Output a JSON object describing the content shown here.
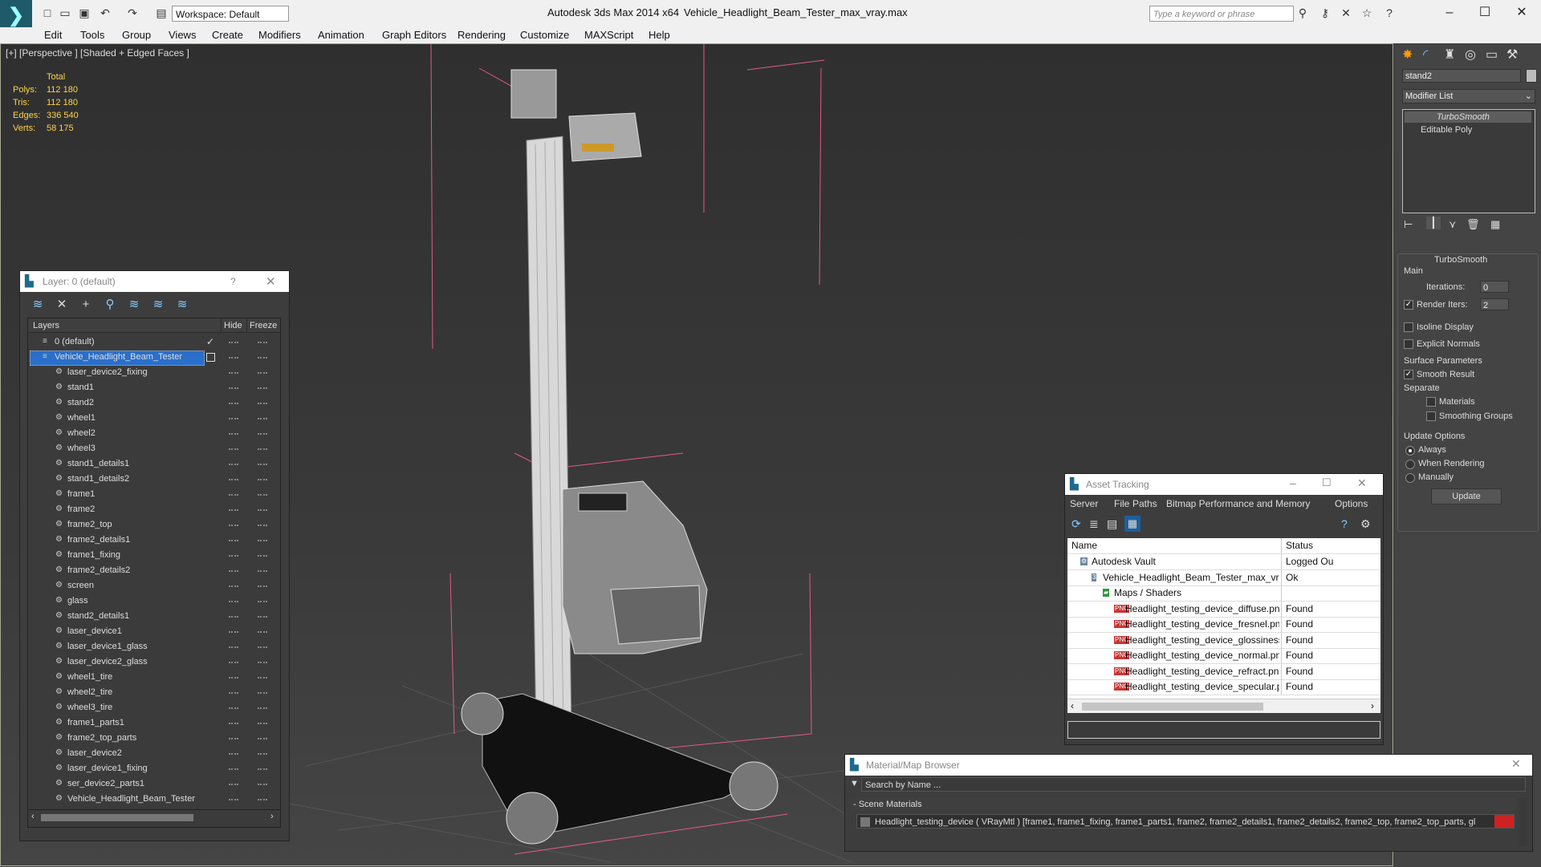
{
  "titlebar": {
    "app": "Autodesk 3ds Max  2014 x64",
    "file": "Vehicle_Headlight_Beam_Tester_max_vray.max",
    "workspace": "Workspace: Default",
    "search_placeholder": "Type a keyword or phrase"
  },
  "menu": [
    "Edit",
    "Tools",
    "Group",
    "Views",
    "Create",
    "Modifiers",
    "Animation",
    "Graph Editors",
    "Rendering",
    "Customize",
    "MAXScript",
    "Help"
  ],
  "viewport": {
    "label": "[+] [Perspective ] [Shaded + Edged Faces ]",
    "stats": {
      "header": "Total",
      "polys_label": "Polys:",
      "polys": "112 180",
      "tris_label": "Tris:",
      "tris": "112 180",
      "edges_label": "Edges:",
      "edges": "336 540",
      "verts_label": "Verts:",
      "verts": "58 175"
    }
  },
  "layer_window": {
    "title": "Layer: 0 (default)",
    "help": "?",
    "columns": {
      "layers": "Layers",
      "hide": "Hide",
      "freeze": "Freeze"
    },
    "rows": [
      "0 (default)",
      "Vehicle_Headlight_Beam_Tester",
      "laser_device2_fixing",
      "stand1",
      "stand2",
      "wheel1",
      "wheel2",
      "wheel3",
      "stand1_details1",
      "stand1_details2",
      "frame1",
      "frame2",
      "frame2_top",
      "frame2_details1",
      "frame1_fixing",
      "frame2_details2",
      "screen",
      "glass",
      "stand2_details1",
      "laser_device1",
      "laser_device1_glass",
      "laser_device2_glass",
      "wheel1_tire",
      "wheel2_tire",
      "wheel3_tire",
      "frame1_parts1",
      "frame2_top_parts",
      "laser_device2",
      "laser_device1_fixing",
      "ser_device2_parts1",
      "Vehicle_Headlight_Beam_Tester"
    ]
  },
  "command_panel": {
    "object_name": "stand2",
    "modifier_list": "Modifier List",
    "stack": [
      "TurboSmooth",
      "Editable Poly"
    ],
    "rollout_title": "TurboSmooth",
    "main_label": "Main",
    "iterations_label": "Iterations:",
    "iterations": "0",
    "render_iters_label": "Render Iters:",
    "render_iters": "2",
    "isoline": "Isoline Display",
    "explicit_normals": "Explicit Normals",
    "surface_params": "Surface Parameters",
    "smooth_result": "Smooth Result",
    "separate": "Separate",
    "materials": "Materials",
    "smoothing_groups": "Smoothing Groups",
    "update_options": "Update Options",
    "always": "Always",
    "when_rendering": "When Rendering",
    "manually": "Manually",
    "update_btn": "Update"
  },
  "asset_tracking": {
    "title": "Asset Tracking",
    "menu": [
      "Server",
      "File",
      "Paths",
      "Bitmap Performance and Memory",
      "Options"
    ],
    "col_name": "Name",
    "col_status": "Status",
    "rows": [
      {
        "name": "Autodesk Vault",
        "status": "Logged Ou"
      },
      {
        "name": "Vehicle_Headlight_Beam_Tester_max_vray.max",
        "status": "Ok"
      },
      {
        "name": "Maps / Shaders",
        "status": ""
      },
      {
        "name": "Headlight_testing_device_diffuse.png",
        "status": "Found"
      },
      {
        "name": "Headlight_testing_device_fresnel.png",
        "status": "Found"
      },
      {
        "name": "Headlight_testing_device_glossiness.png",
        "status": "Found"
      },
      {
        "name": "Headlight_testing_device_normal.png",
        "status": "Found"
      },
      {
        "name": "Headlight_testing_device_refract.png",
        "status": "Found"
      },
      {
        "name": "Headlight_testing_device_specular.png",
        "status": "Found"
      }
    ]
  },
  "material_browser": {
    "title": "Material/Map Browser",
    "search_placeholder": "Search by Name ...",
    "section": "- Scene Materials",
    "entry": "Headlight_testing_device  ( VRayMtl ) [frame1, frame1_fixing, frame1_parts1, frame2, frame2_details1, frame2_details2, frame2_top, frame2_top_parts, gl"
  }
}
